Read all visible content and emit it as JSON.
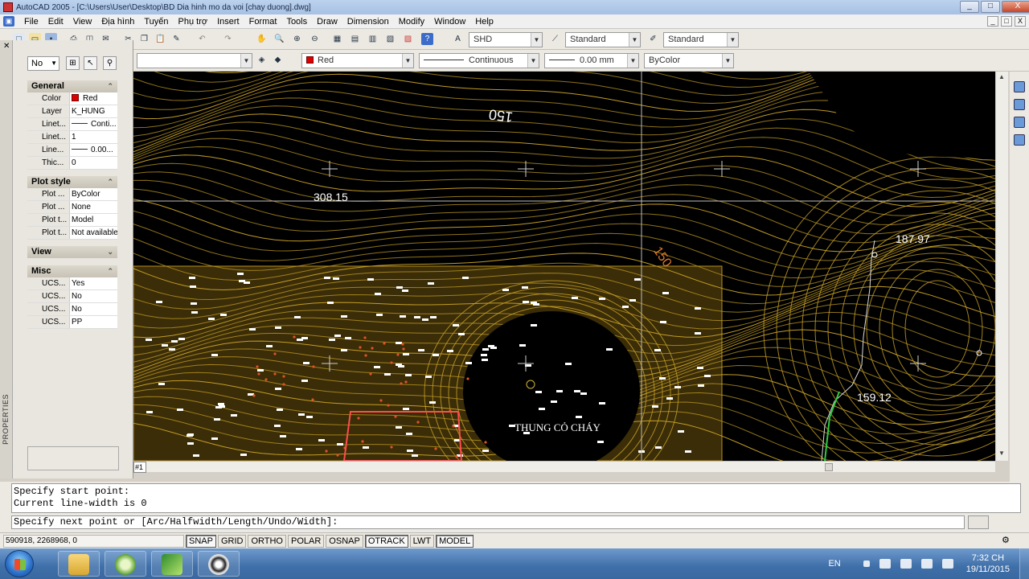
{
  "window": {
    "title": "AutoCAD 2005 - [C:\\Users\\User\\Desktop\\BD Dia hinh mo da voi [chay duong].dwg]",
    "controls": [
      "_",
      "□",
      "X"
    ]
  },
  "menu": [
    "File",
    "Edit",
    "View",
    "Địa hình",
    "Tuyến",
    "Phụ trợ",
    "Insert",
    "Format",
    "Tools",
    "Draw",
    "Dimension",
    "Modify",
    "Window",
    "Help"
  ],
  "doc_controls": [
    "_",
    "□",
    "X"
  ],
  "toolbar": {
    "text_style": "SHD",
    "dim_style": "Standard",
    "table_style": "Standard",
    "color": "Red",
    "linetype": "Continuous",
    "lineweight": "0.00 mm",
    "plotstyle": "ByColor"
  },
  "properties": {
    "palette_title": "PROPERTIES",
    "selection": "No",
    "sections": {
      "general": {
        "title": "General",
        "rows": [
          {
            "k": "Color",
            "v": "Red"
          },
          {
            "k": "Layer",
            "v": "K_HUNG"
          },
          {
            "k": "Linet...",
            "v": "Conti..."
          },
          {
            "k": "Linet...",
            "v": "1"
          },
          {
            "k": "Line...",
            "v": "0.00..."
          },
          {
            "k": "Thic...",
            "v": "0"
          }
        ]
      },
      "plot_style": {
        "title": "Plot style",
        "rows": [
          {
            "k": "Plot ...",
            "v": "ByColor"
          },
          {
            "k": "Plot ...",
            "v": "None"
          },
          {
            "k": "Plot t...",
            "v": "Model"
          },
          {
            "k": "Plot t...",
            "v": "Not available"
          }
        ]
      },
      "view": {
        "title": "View"
      },
      "misc": {
        "title": "Misc",
        "rows": [
          {
            "k": "UCS...",
            "v": "Yes"
          },
          {
            "k": "UCS...",
            "v": "No"
          },
          {
            "k": "UCS...",
            "v": "No"
          },
          {
            "k": "UCS...",
            "v": "PP"
          }
        ]
      }
    }
  },
  "drawing": {
    "labels": {
      "elev1": "150",
      "elev2": "308.15",
      "elev3": "150",
      "elev4": "187.97",
      "elev5": "159.12",
      "place": "THUNG CỎ CHÁY"
    },
    "colors": {
      "contour": "#c9a227",
      "region": "#8a6a12",
      "boundary": "#ff4d4d",
      "green": "#2ecc40",
      "background": "#000000"
    }
  },
  "layout_tab": "#1",
  "command": {
    "history": [
      "Specify start point:",
      "Current line-width is 0"
    ],
    "prompt": "Specify next point or [Arc/Halfwidth/Length/Undo/Width]:"
  },
  "status": {
    "coords": "590918, 2268968, 0",
    "buttons": [
      {
        "label": "SNAP",
        "on": true
      },
      {
        "label": "GRID",
        "on": false
      },
      {
        "label": "ORTHO",
        "on": false
      },
      {
        "label": "POLAR",
        "on": false
      },
      {
        "label": "OSNAP",
        "on": false
      },
      {
        "label": "OTRACK",
        "on": true
      },
      {
        "label": "LWT",
        "on": false
      },
      {
        "label": "MODEL",
        "on": true
      }
    ]
  },
  "taskbar": {
    "language": "EN",
    "time": "7:32 CH",
    "date": "19/11/2015"
  }
}
